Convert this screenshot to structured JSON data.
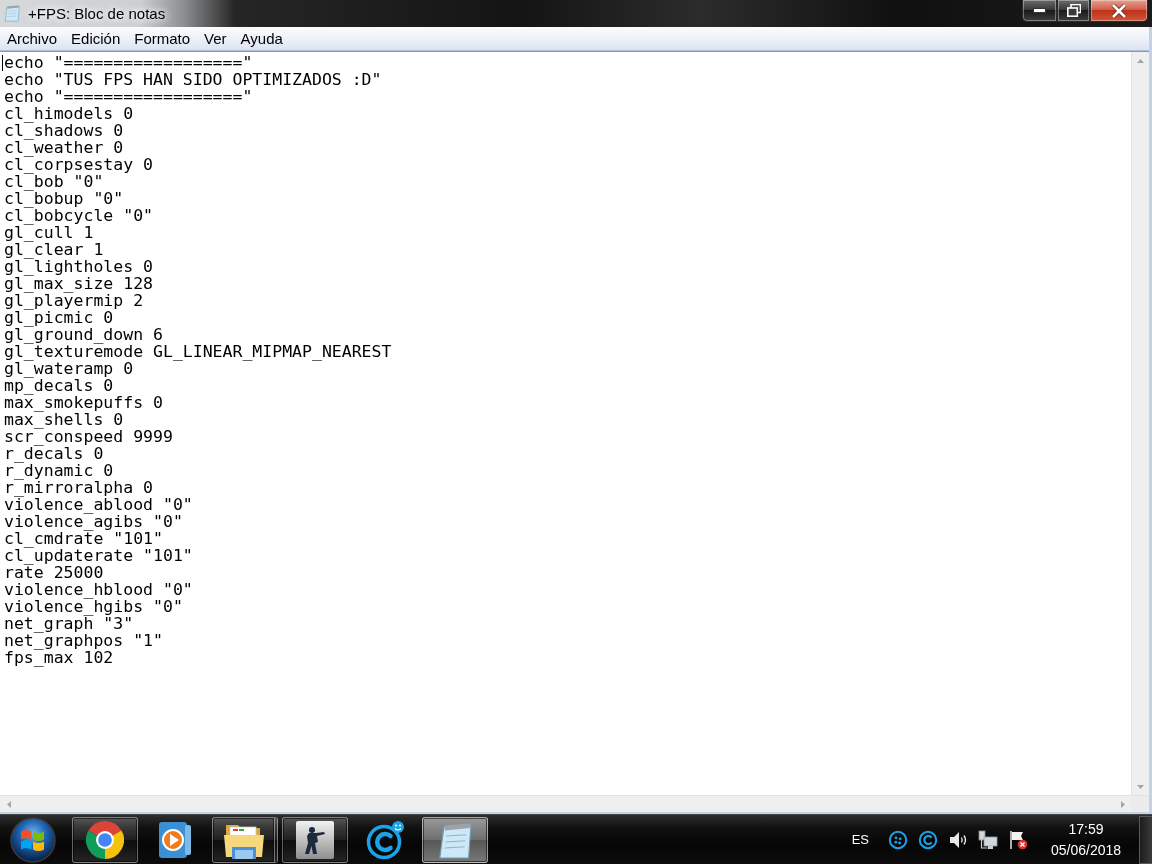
{
  "window": {
    "title": "+FPS: Bloc de notas"
  },
  "menu": [
    "Archivo",
    "Edición",
    "Formato",
    "Ver",
    "Ayuda"
  ],
  "document": {
    "lines": [
      "echo \"==================\"",
      "echo \"TUS FPS HAN SIDO OPTIMIZADOS :D\"",
      "echo \"==================\"",
      "cl_himodels 0",
      "cl_shadows 0",
      "cl_weather 0",
      "cl_corpsestay 0",
      "cl_bob \"0\"",
      "cl_bobup \"0\"",
      "cl_bobcycle \"0\"",
      "gl_cull 1",
      "gl_clear 1",
      "gl_lightholes 0",
      "gl_max_size 128",
      "gl_playermip 2",
      "gl_picmic 0",
      "gl_ground_down 6",
      "gl_texturemode GL_LINEAR_MIPMAP_NEAREST",
      "gl_wateramp 0",
      "mp_decals 0",
      "max_smokepuffs 0",
      "max_shells 0",
      "scr_conspeed 9999",
      "r_decals 0",
      "r_dynamic 0",
      "r_mirroralpha 0",
      "violence_ablood \"0\"",
      "violence_agibs \"0\"",
      "cl_cmdrate \"101\"",
      "cl_updaterate \"101\"",
      "rate 25000",
      "violence_hblood \"0\"",
      "violence_hgibs \"0\"",
      "net_graph \"3\"",
      "net_graphpos \"1\"",
      "fps_max 102"
    ]
  },
  "taskbar": {
    "apps": [
      {
        "kind": "browser",
        "running": true,
        "stacked": false,
        "selected": false
      },
      {
        "kind": "media",
        "running": false,
        "stacked": false,
        "selected": false
      },
      {
        "kind": "folder",
        "running": true,
        "stacked": true,
        "selected": false
      },
      {
        "kind": "game",
        "running": true,
        "stacked": false,
        "selected": false
      },
      {
        "kind": "chat",
        "running": false,
        "stacked": false,
        "selected": false
      },
      {
        "kind": "notepad",
        "running": true,
        "stacked": false,
        "selected": true
      }
    ],
    "language": "ES",
    "clock": {
      "time": "17:59",
      "date": "05/06/2018"
    }
  }
}
